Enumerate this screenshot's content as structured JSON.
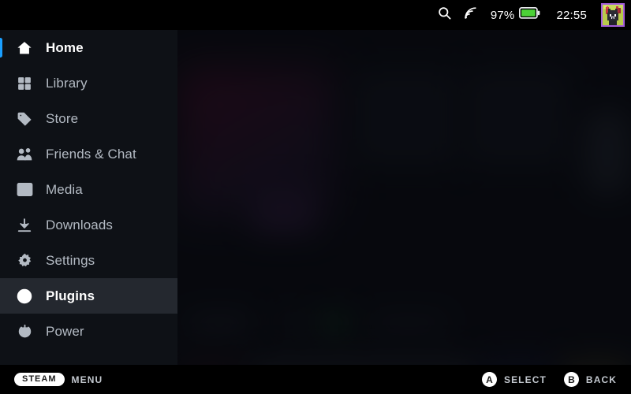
{
  "status_bar": {
    "search_icon": "search-icon",
    "network_icon": "wifi-icon",
    "battery_percent": "97%",
    "battery_icon": "battery-icon",
    "battery_level": 97,
    "battery_color": "#4cd137",
    "clock": "22:55",
    "avatar_icon": "user-avatar",
    "avatar_border_color": "#a35dd9"
  },
  "sidebar": {
    "background_color": "#0e1116",
    "selected_background_color": "#24282f",
    "accent_color": "#1a9fff",
    "items": [
      {
        "label": "Home",
        "icon": "home-icon",
        "state": "active"
      },
      {
        "label": "Library",
        "icon": "grid-icon",
        "state": "normal"
      },
      {
        "label": "Store",
        "icon": "tag-icon",
        "state": "normal"
      },
      {
        "label": "Friends & Chat",
        "icon": "friends-icon",
        "state": "normal"
      },
      {
        "label": "Media",
        "icon": "image-icon",
        "state": "normal"
      },
      {
        "label": "Downloads",
        "icon": "download-icon",
        "state": "normal"
      },
      {
        "label": "Settings",
        "icon": "gear-icon",
        "state": "normal"
      },
      {
        "label": "Plugins",
        "icon": "plugin-icon",
        "state": "selected"
      },
      {
        "label": "Power",
        "icon": "power-icon",
        "state": "normal"
      }
    ]
  },
  "footer": {
    "left_hints": [
      {
        "badge": "STEAM",
        "badge_type": "pill",
        "label": "MENU"
      }
    ],
    "right_hints": [
      {
        "badge": "A",
        "badge_type": "circle",
        "label": "SELECT"
      },
      {
        "badge": "B",
        "badge_type": "circle",
        "label": "BACK"
      }
    ]
  }
}
